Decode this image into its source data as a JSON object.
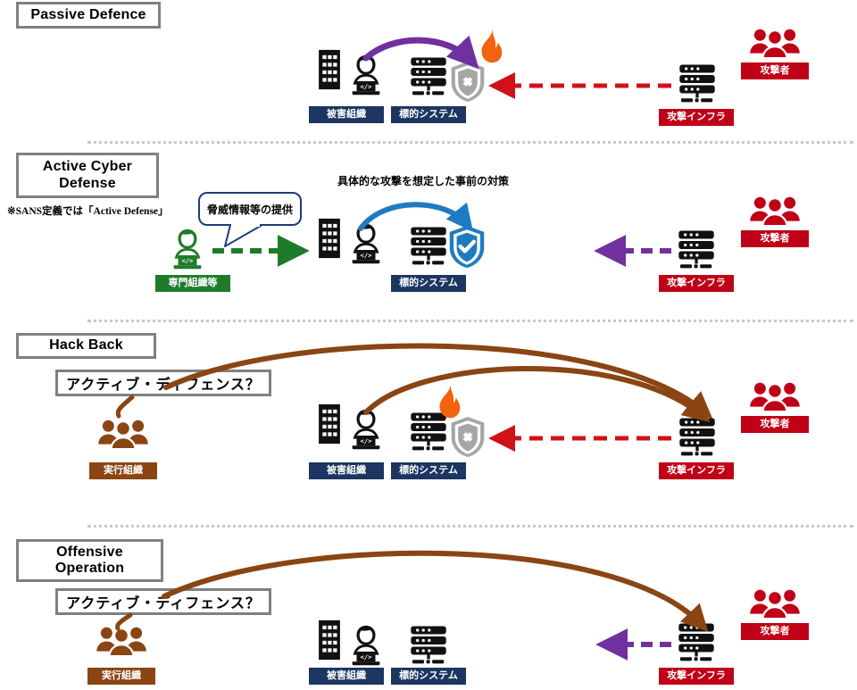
{
  "sections": [
    {
      "id": "passive-defence",
      "title": "Passive Defence",
      "note": null
    },
    {
      "id": "active-cyber-defense",
      "title": "Active Cyber\nDefense",
      "note": "※SANS定義では「Active Defense」"
    },
    {
      "id": "hack-back",
      "title": "Hack Back",
      "note": null
    },
    {
      "id": "offensive-operation",
      "title": "Offensive\nOperation",
      "note": null
    }
  ],
  "section_titles": {
    "passive": "Passive Defence",
    "active_line1": "Active Cyber",
    "active_line2": "Defense",
    "active_note": "※SANS定義では「Active Defense」",
    "hackback": "Hack Back",
    "offensive_line1": "Offensive",
    "offensive_line2": "Operation"
  },
  "labels": {
    "victim_org": "被害組織",
    "target_system": "標的システム",
    "attack_infra": "攻撃インフラ",
    "attacker": "攻撃者",
    "expert_org": "専門組織等",
    "executing_org": "実行組織",
    "active_defense_question": "アクティブ・ディフェンス？"
  },
  "callouts": {
    "threat_intel": "脅威情報等の提供",
    "preemptive_measure": "具体的な攻撃を想定した事前の対策"
  },
  "colors": {
    "navy": "#1c3561",
    "red": "#c00016",
    "green": "#1e7b2a",
    "brown": "#8a4513",
    "purple": "#7030a0",
    "blue": "#1f7bc1",
    "gray": "#808080",
    "flame_orange": "#f3620f",
    "shield_gray": "#a6a6a6",
    "shield_blue": "#1f7bc1",
    "divider": "#c8c8c8"
  },
  "icons": {
    "building": "building-icon",
    "person_laptop": "person-laptop-icon",
    "server": "server-icon",
    "people_group": "people-group-icon",
    "flame": "flame-icon",
    "shield_x": "shield-x-icon",
    "shield_check": "shield-check-icon"
  },
  "arrows": {
    "passive_attack": "red-dashed-arrow-left",
    "passive_internal": "purple-curved-arrow",
    "active_intel": "green-dashed-arrow-right",
    "active_measure": "blue-curved-arrow",
    "active_probe": "purple-dashed-arrow-left",
    "hackback_counter": "brown-curved-arrow",
    "offensive_counter": "brown-curved-arrow"
  }
}
